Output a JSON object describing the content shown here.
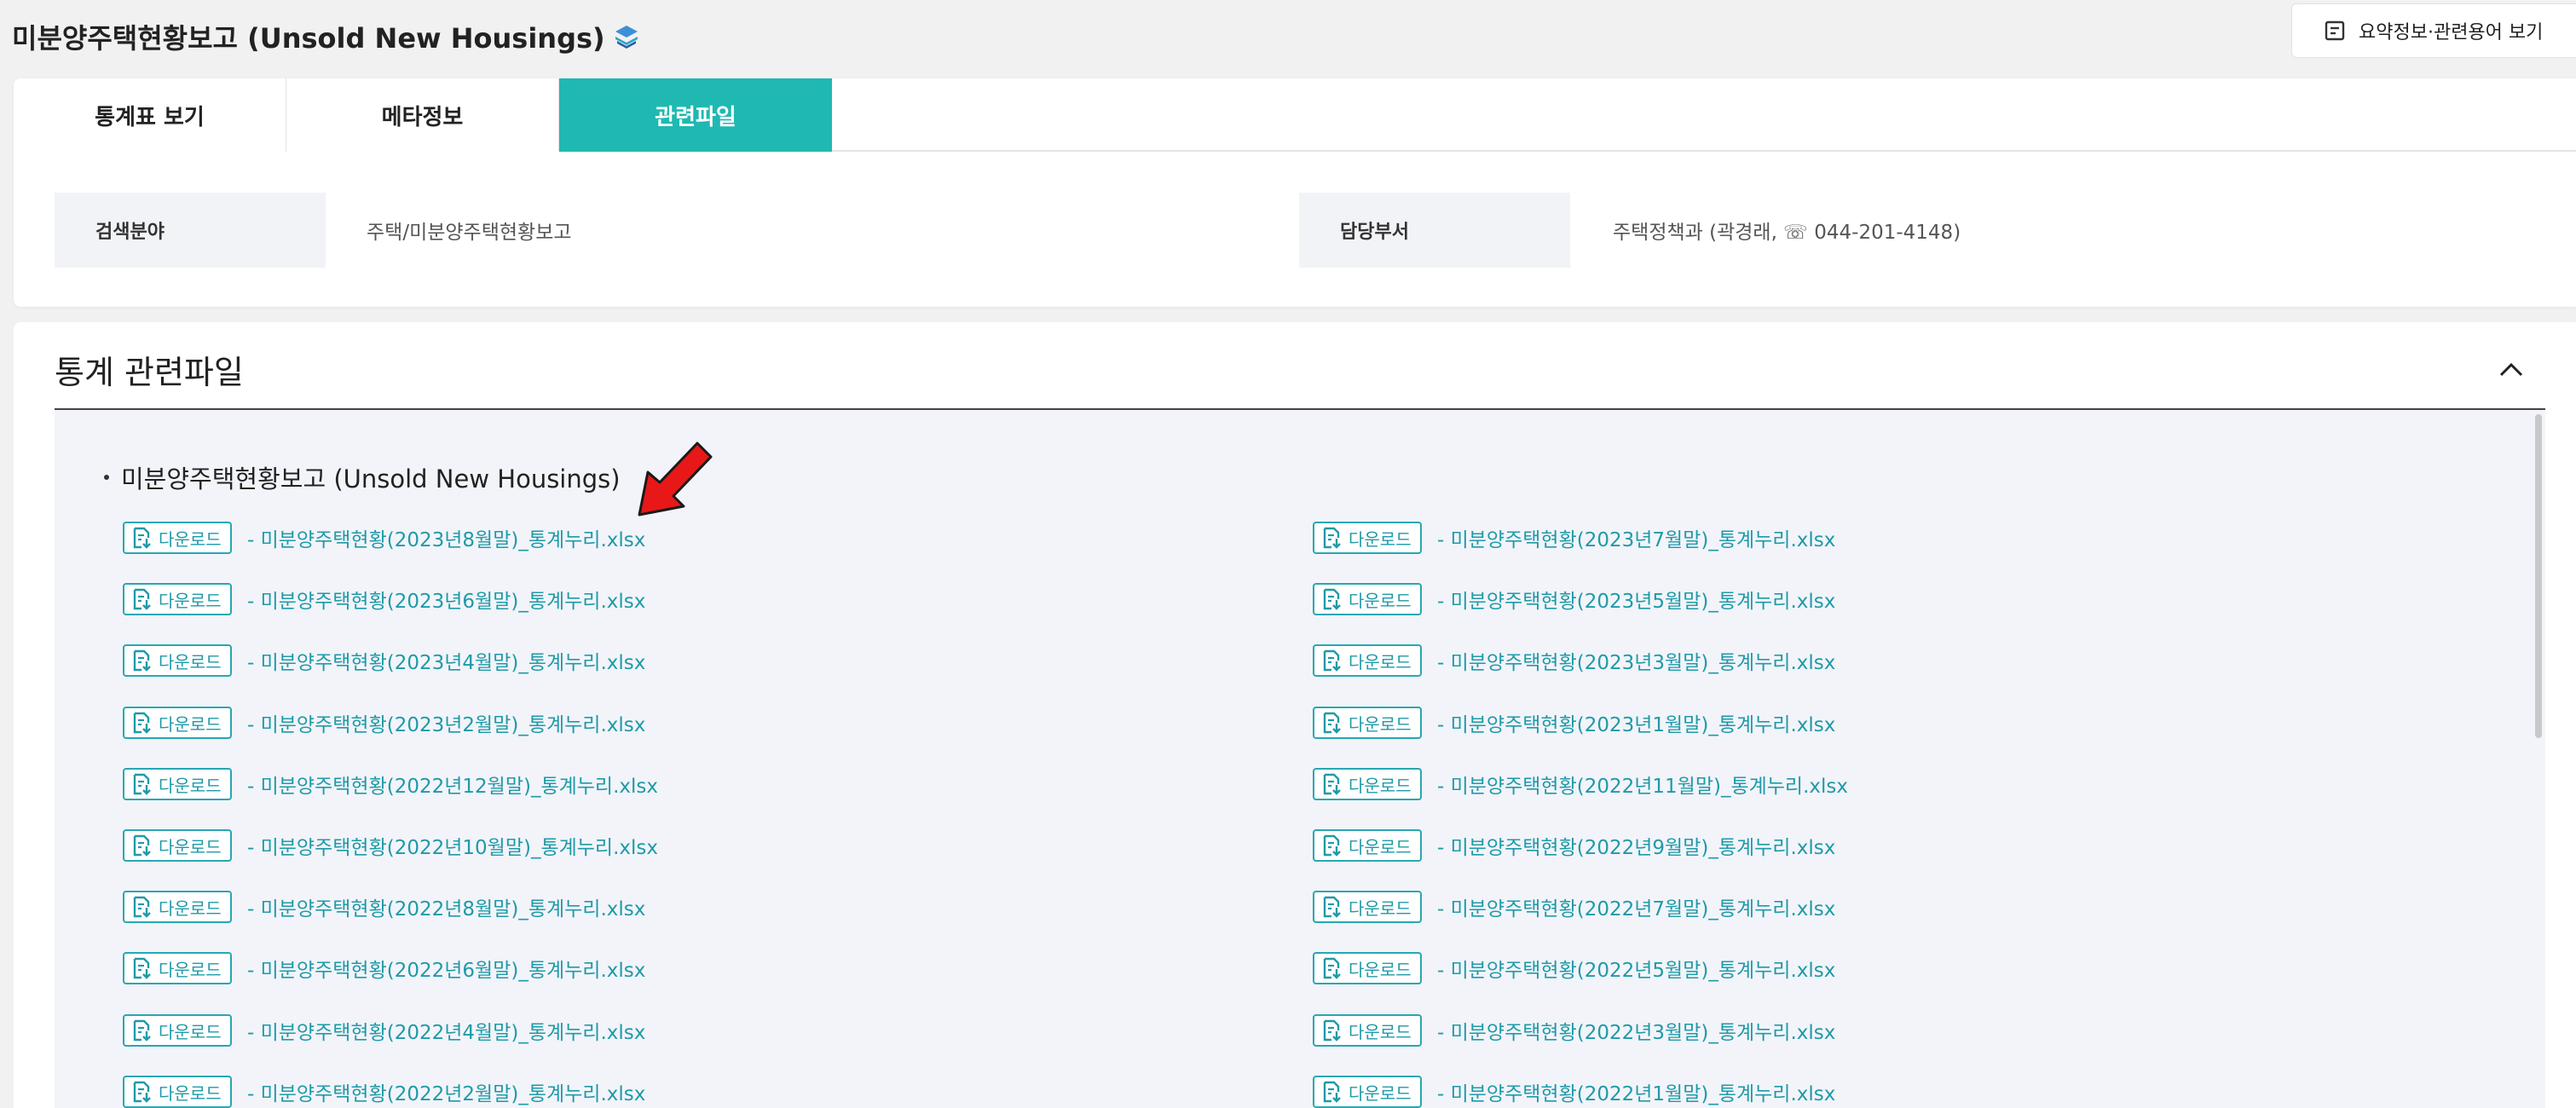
{
  "header": {
    "title": "미분양주택현황보고 (Unsold New Housings)",
    "summary_button_label": "요약정보·관련용어 보기"
  },
  "tabs": [
    {
      "label": "통계표 보기",
      "active": false
    },
    {
      "label": "메타정보",
      "active": false
    },
    {
      "label": "관련파일",
      "active": true
    }
  ],
  "info": {
    "field_label": "검색분야",
    "field_value": "주택/미분양주택현황보고",
    "dept_label": "담당부서",
    "dept_value": "주택정책과 (곽경래, ☏ 044-201-4148)"
  },
  "files_section": {
    "title": "통계 관련파일",
    "group_title": "미분양주택현황보고 (Unsold New Housings)",
    "download_label": "다운로드",
    "left_column": [
      "- 미분양주택현황(2023년8월말)_통계누리.xlsx",
      "- 미분양주택현황(2023년6월말)_통계누리.xlsx",
      "- 미분양주택현황(2023년4월말)_통계누리.xlsx",
      "- 미분양주택현황(2023년2월말)_통계누리.xlsx",
      "- 미분양주택현황(2022년12월말)_통계누리.xlsx",
      "- 미분양주택현황(2022년10월말)_통계누리.xlsx",
      "- 미분양주택현황(2022년8월말)_통계누리.xlsx",
      "- 미분양주택현황(2022년6월말)_통계누리.xlsx",
      "- 미분양주택현황(2022년4월말)_통계누리.xlsx",
      "- 미분양주택현황(2022년2월말)_통계누리.xlsx"
    ],
    "right_column": [
      "- 미분양주택현황(2023년7월말)_통계누리.xlsx",
      "- 미분양주택현황(2023년5월말)_통계누리.xlsx",
      "- 미분양주택현황(2023년3월말)_통계누리.xlsx",
      "- 미분양주택현황(2023년1월말)_통계누리.xlsx",
      "- 미분양주택현황(2022년11월말)_통계누리.xlsx",
      "- 미분양주택현황(2022년9월말)_통계누리.xlsx",
      "- 미분양주택현황(2022년7월말)_통계누리.xlsx",
      "- 미분양주택현황(2022년5월말)_통계누리.xlsx",
      "- 미분양주택현황(2022년3월말)_통계누리.xlsx",
      "- 미분양주택현황(2022년1월말)_통계누리.xlsx"
    ]
  },
  "colors": {
    "accent": "#1fb9b2",
    "link": "#1f9aa8",
    "annotation_arrow": "#e81818"
  },
  "icons": {
    "title_logo": "layers-logo-icon",
    "summary": "document-list-icon",
    "collapse": "chevron-up-icon",
    "download": "file-download-icon",
    "annotation": "red-arrow-annotation"
  }
}
